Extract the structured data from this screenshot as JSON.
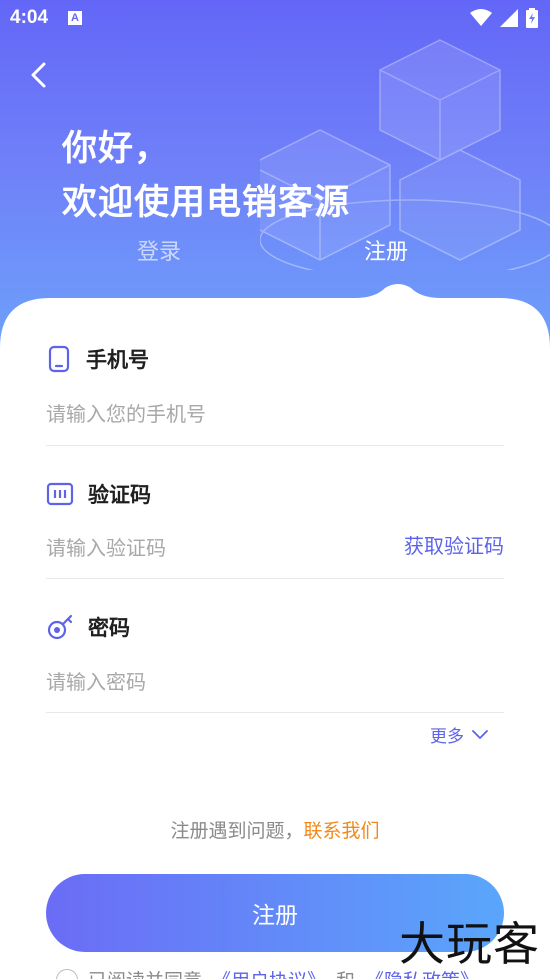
{
  "status_bar": {
    "time": "4:04",
    "notification_badge": "A"
  },
  "header": {
    "greeting_line1": "你好，",
    "greeting_line2": "欢迎使用电销客源"
  },
  "tabs": {
    "login": "登录",
    "register": "注册"
  },
  "form": {
    "phone": {
      "label": "手机号",
      "placeholder": "请输入您的手机号"
    },
    "code": {
      "label": "验证码",
      "placeholder": "请输入验证码",
      "action": "获取验证码"
    },
    "password": {
      "label": "密码",
      "placeholder": "请输入密码"
    },
    "more": "更多"
  },
  "help": {
    "text": "注册遇到问题，",
    "contact": "联系我们"
  },
  "submit_label": "注册",
  "agreement": {
    "prefix": "已阅读并同意",
    "user_agreement": "《用户协议》",
    "and": "和",
    "privacy_policy": "《隐私政策》"
  },
  "watermark": "大玩客",
  "colors": {
    "accent": "#5d63ea",
    "header_top": "#6366f7",
    "header_bottom": "#6ea2fb",
    "contact": "#f08a1c"
  }
}
